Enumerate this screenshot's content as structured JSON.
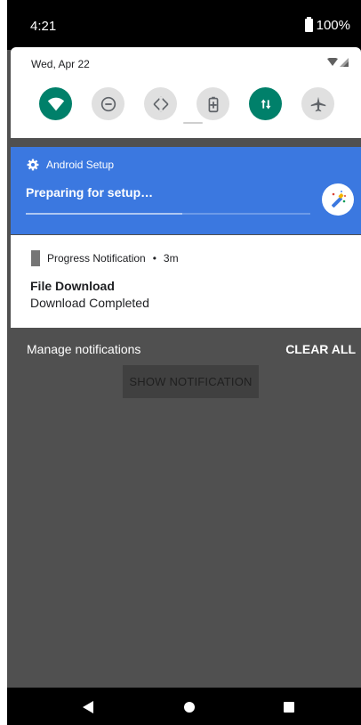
{
  "status_bar": {
    "time": "4:21",
    "battery": "100%"
  },
  "quick_settings": {
    "date": "Wed, Apr 22",
    "tiles": [
      {
        "icon": "wifi-icon",
        "state": "on"
      },
      {
        "icon": "do-not-disturb-icon",
        "state": "off"
      },
      {
        "icon": "auto-rotate-icon",
        "state": "off"
      },
      {
        "icon": "battery-saver-icon",
        "state": "off"
      },
      {
        "icon": "mobile-data-icon",
        "state": "on"
      },
      {
        "icon": "airplane-mode-icon",
        "state": "off"
      }
    ]
  },
  "setup_notification": {
    "app_name": "Android Setup",
    "title": "Preparing for setup…",
    "progress": 0.55,
    "color": "#3b78e0"
  },
  "progress_notification": {
    "app_name": "Progress Notification",
    "time": "3m",
    "title": "File Download",
    "text": "Download Completed"
  },
  "shade_footer": {
    "manage_label": "Manage notifications",
    "clear_label": "CLEAR ALL"
  },
  "app": {
    "button_label": "SHOW NOTIFICATION"
  },
  "colors": {
    "accent_on": "#00806a",
    "tile_off": "#e0e0e0",
    "scrim": "#505050"
  }
}
